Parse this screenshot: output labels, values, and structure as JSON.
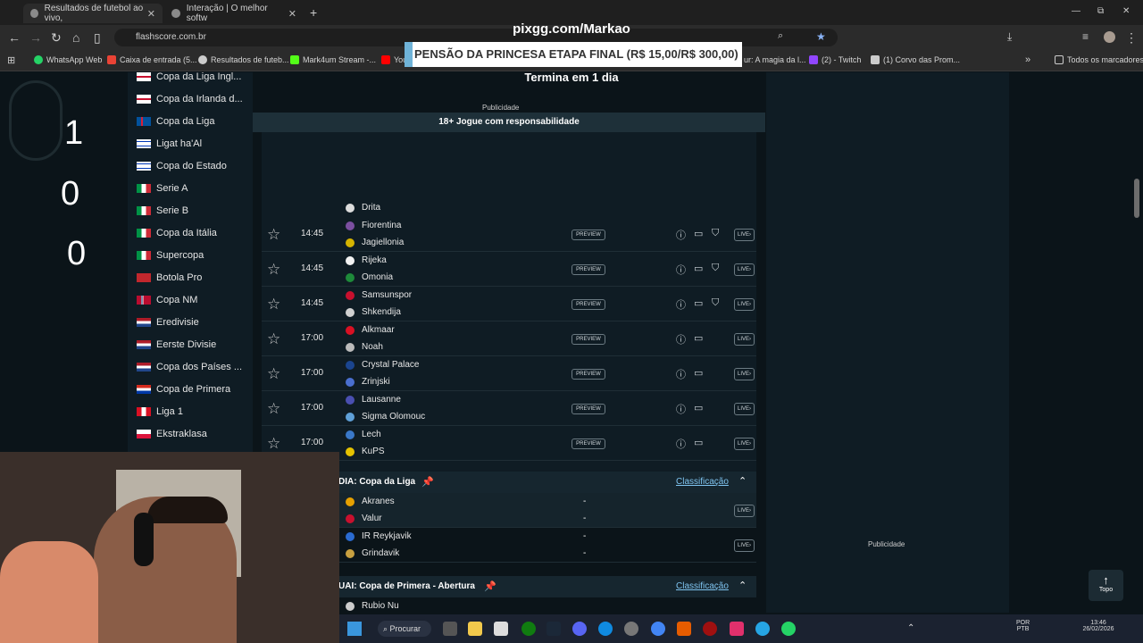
{
  "browser": {
    "tabs": [
      {
        "title": "Resultados de futebol ao vivo, ",
        "active": true
      },
      {
        "title": "Interação | O melhor softw",
        "active": false
      }
    ],
    "new_tab": "+",
    "url": "flashscore.com.br",
    "window_controls": {
      "minimize": "—",
      "restore": "⧉",
      "close": "✕"
    }
  },
  "bookmarks": [
    {
      "label": "WhatsApp Web",
      "color": "#25d366"
    },
    {
      "label": "Caixa de entrada (5...",
      "color": "#ea4335"
    },
    {
      "label": "Resultados de futeb...",
      "color": "#cccccc"
    },
    {
      "label": "Mark4um Stream -...",
      "color": "#53fc18"
    },
    {
      "label": "You",
      "color": "#ff0000"
    },
    {
      "label": "ur: A magia da l...",
      "color": "#cccccc"
    },
    {
      "label": "(2) - Twitch",
      "color": "#9146ff"
    },
    {
      "label": "(1) Corvo das Prom...",
      "color": "#cccccc"
    }
  ],
  "all_bookmarks": "Todos os marcadores",
  "stream": {
    "title": "pixgg.com/Markao",
    "banner": "PENSÃO DA PRINCESA ETAPA FINAL (R$ 15,00/R$ 300,00)",
    "subtitle": "Termina em 1 dia",
    "counters": [
      "1",
      "0",
      "0"
    ]
  },
  "leagues": [
    {
      "name": "Copa da Liga Ingl...",
      "flag": "eng"
    },
    {
      "name": "Copa da Irlanda d...",
      "flag": "nir"
    },
    {
      "name": "Copa da Liga",
      "flag": "isl"
    },
    {
      "name": "Ligat ha'Al",
      "flag": "isr"
    },
    {
      "name": "Copa do Estado",
      "flag": "isr"
    },
    {
      "name": "Serie A",
      "flag": "ita"
    },
    {
      "name": "Serie B",
      "flag": "ita"
    },
    {
      "name": "Copa da Itália",
      "flag": "ita"
    },
    {
      "name": "Supercopa",
      "flag": "ita"
    },
    {
      "name": "Botola Pro",
      "flag": "mar"
    },
    {
      "name": "Copa NM",
      "flag": "nor"
    },
    {
      "name": "Eredivisie",
      "flag": "ned"
    },
    {
      "name": "Eerste Divisie",
      "flag": "ned"
    },
    {
      "name": "Copa dos Países ...",
      "flag": "ned"
    },
    {
      "name": "Copa de Primera",
      "flag": "par"
    },
    {
      "name": "Liga 1",
      "flag": "per"
    },
    {
      "name": "Ekstraklasa",
      "flag": "pol"
    }
  ],
  "ad_label": "Publicidade",
  "responsibility": "18+ Jogue com responsabilidade",
  "partial_team": "Drita",
  "matches": [
    {
      "time": "14:45",
      "home": "Fiorentina",
      "away": "Jagiellonia",
      "preview": "PREVIEW",
      "live": "LIVE",
      "icons": 3
    },
    {
      "time": "14:45",
      "home": "Rijeka",
      "away": "Omonia",
      "preview": "PREVIEW",
      "live": "LIVE",
      "icons": 3
    },
    {
      "time": "14:45",
      "home": "Samsunspor",
      "away": "Shkendija",
      "preview": "PREVIEW",
      "live": "LIVE",
      "icons": 3
    },
    {
      "time": "17:00",
      "home": "Alkmaar",
      "away": "Noah",
      "preview": "PREVIEW",
      "live": "LIVE",
      "icons": 2
    },
    {
      "time": "17:00",
      "home": "Crystal Palace",
      "away": "Zrinjski",
      "preview": "PREVIEW",
      "live": "LIVE",
      "icons": 2
    },
    {
      "time": "17:00",
      "home": "Lausanne",
      "away": "Sigma Olomouc",
      "preview": "PREVIEW",
      "live": "LIVE",
      "icons": 2
    },
    {
      "time": "17:00",
      "home": "Lech",
      "away": "KuPS",
      "preview": "PREVIEW",
      "live": "LIVE",
      "icons": 2
    }
  ],
  "competitions": [
    {
      "name": "DIA: Copa da Liga",
      "standings": "Classificação",
      "matches": [
        {
          "home": "Akranes",
          "away": "Valur",
          "live": "LIVE"
        },
        {
          "home": "IR Reykjavik",
          "away": "Grindavik",
          "live": "LIVE"
        }
      ]
    },
    {
      "name": "UAI: Copa de Primera - Abertura",
      "standings": "Classificação",
      "matches": [
        {
          "home": "Rubio Nu"
        }
      ]
    }
  ],
  "score_dash": "-",
  "ad_label_2": "Publicidade",
  "top_button": "Topo",
  "taskbar": {
    "search": "Procurar",
    "lang": "POR",
    "layout": "PTB",
    "time": "13:46",
    "date": "26/02/2026"
  }
}
